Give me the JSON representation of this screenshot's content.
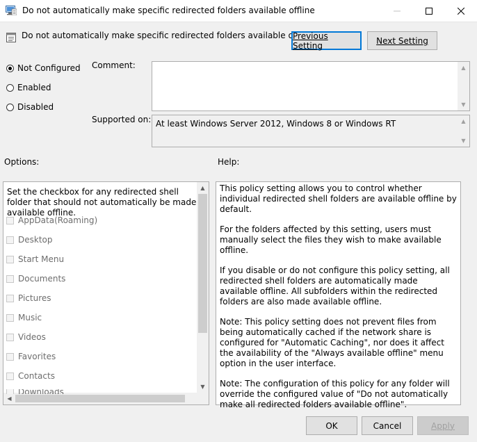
{
  "window": {
    "title": "Do not automatically make specific redirected folders available offline"
  },
  "header": {
    "policy_title": "Do not automatically make specific redirected folders available offline",
    "previous_setting": "Previous Setting",
    "next_setting": "Next Setting"
  },
  "state": {
    "not_configured": "Not Configured",
    "enabled": "Enabled",
    "disabled": "Disabled",
    "selected": "Not Configured"
  },
  "comment": {
    "label": "Comment:",
    "value": ""
  },
  "supported": {
    "label": "Supported on:",
    "value": "At least Windows Server 2012, Windows 8 or Windows RT"
  },
  "options": {
    "label": "Options:",
    "description": "Set the checkbox for any redirected shell folder that should not automatically be made available offline.",
    "folders": [
      "AppData(Roaming)",
      "Desktop",
      "Start Menu",
      "Documents",
      "Pictures",
      "Music",
      "Videos",
      "Favorites",
      "Contacts",
      "Downloads"
    ]
  },
  "help": {
    "label": "Help:",
    "paragraphs": [
      "This policy setting allows you to control whether individual redirected shell folders are available offline by default.",
      "For the folders affected by this setting, users must manually select the files they wish to make available offline.",
      "If you disable or do not configure this policy setting, all redirected shell folders are automatically made available offline. All subfolders within the redirected folders are also made available offline.",
      "Note: This policy setting does not prevent files from being automatically cached if the network share is configured for \"Automatic Caching\", nor does it affect the availability of the \"Always available offline\" menu option in the user interface.",
      "Note: The configuration of this policy for any folder will override the configured value of \"Do not automatically make all redirected folders available offline\"."
    ]
  },
  "buttons": {
    "ok": "OK",
    "cancel": "Cancel",
    "apply": "Apply"
  },
  "colors": {
    "accent": "#0078d7",
    "window_bg": "#f0f0f0"
  }
}
